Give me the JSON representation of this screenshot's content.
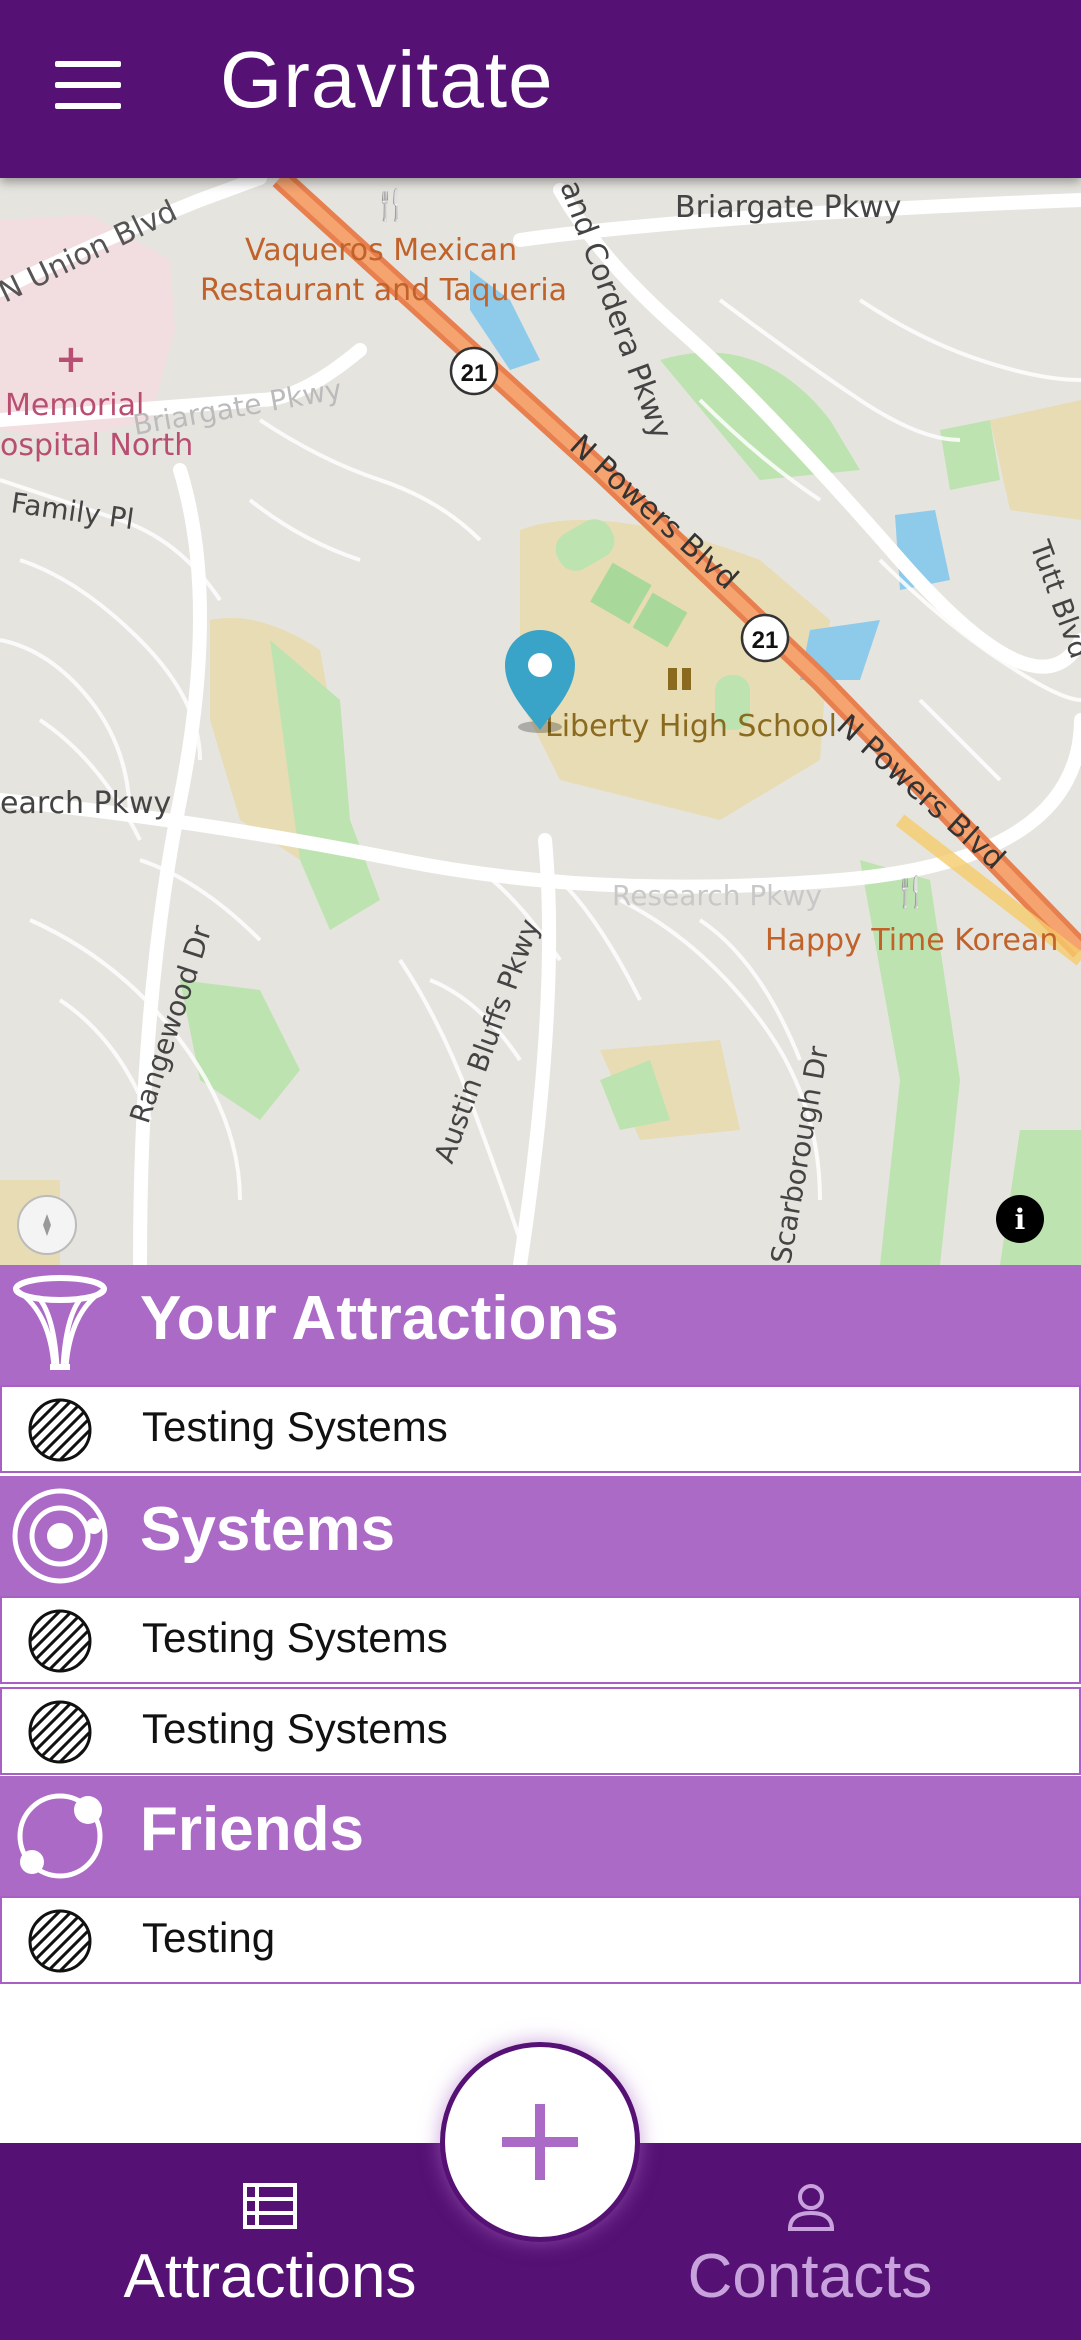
{
  "app": {
    "title": "Gravitate"
  },
  "map": {
    "labels": {
      "union_blvd": "N Union Blvd",
      "vaqueros_line1": "Vaqueros Mexican",
      "vaqueros_line2": "Restaurant and Taqueria",
      "briargate": "Briargate Pkwy",
      "cordera": "and Cordera Pkwy",
      "memorial_line1": "Memorial",
      "memorial_line2": "ospital North",
      "briargate_faded": "Briargate Pkwy",
      "family_pl": "Family Pl",
      "powers_1": "N Powers Blvd",
      "powers_2": "N Powers Blvd",
      "tutt": "Tutt Blvd",
      "liberty": "Liberty High School",
      "research": "earch Pkwy",
      "research_faded": "Research Pkwy",
      "happy_time": "Happy Time Korean",
      "rangewood": "Rangewood Dr",
      "austin_bluffs": "Austin Bluffs Pkwy",
      "scarborough": "Scarborough Dr",
      "route_21_a": "21",
      "route_21_b": "21"
    },
    "info_button": "i"
  },
  "sections": {
    "attractions": {
      "title": "Your Attractions",
      "items": [
        {
          "label": "Testing Systems"
        }
      ]
    },
    "systems": {
      "title": "Systems",
      "items": [
        {
          "label": "Testing Systems"
        },
        {
          "label": "Testing Systems"
        }
      ]
    },
    "friends": {
      "title": "Friends",
      "items": [
        {
          "label": "Testing"
        }
      ]
    }
  },
  "bottom_nav": {
    "attractions": {
      "label": "Attractions",
      "active": true
    },
    "contacts": {
      "label": "Contacts",
      "active": false
    }
  },
  "colors": {
    "primary": "#551173",
    "section": "#ab6ac6",
    "fab_plus": "#ab6ac6",
    "inactive_nav": "#c8a2dc"
  },
  "icons": {
    "menu": "hamburger-icon",
    "attractions_section": "funnel-icon",
    "systems_section": "orbit-icon",
    "friends_section": "binary-orbit-icon",
    "list_avatar": "hatched-circle-icon",
    "nav_attractions": "list-icon",
    "nav_contacts": "person-icon",
    "fab": "plus-icon"
  }
}
